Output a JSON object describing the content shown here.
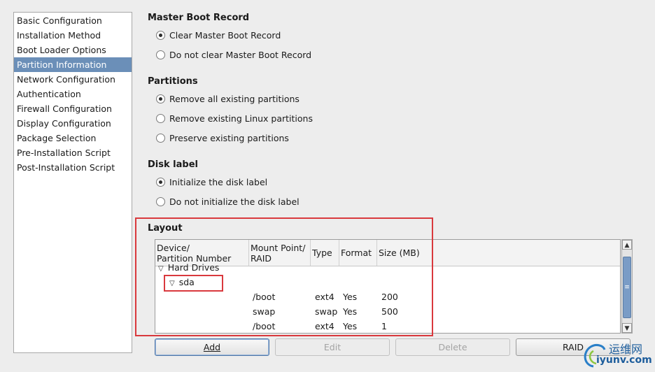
{
  "sidebar": {
    "items": [
      {
        "label": "Basic Configuration"
      },
      {
        "label": "Installation Method"
      },
      {
        "label": "Boot Loader Options"
      },
      {
        "label": "Partition Information",
        "selected": true
      },
      {
        "label": "Network Configuration"
      },
      {
        "label": "Authentication"
      },
      {
        "label": "Firewall Configuration"
      },
      {
        "label": "Display Configuration"
      },
      {
        "label": "Package Selection"
      },
      {
        "label": "Pre-Installation Script"
      },
      {
        "label": "Post-Installation Script"
      }
    ]
  },
  "mbr": {
    "title": "Master Boot Record",
    "options": [
      {
        "label": "Clear Master Boot Record",
        "checked": true
      },
      {
        "label": "Do not clear Master Boot Record",
        "checked": false
      }
    ]
  },
  "partitions": {
    "title": "Partitions",
    "options": [
      {
        "label": "Remove all existing partitions",
        "checked": true
      },
      {
        "label": "Remove existing Linux partitions",
        "checked": false
      },
      {
        "label": "Preserve existing partitions",
        "checked": false
      }
    ]
  },
  "disklabel": {
    "title": "Disk label",
    "options": [
      {
        "label": "Initialize the disk label",
        "checked": true
      },
      {
        "label": "Do not initialize the disk label",
        "checked": false
      }
    ]
  },
  "layout": {
    "title": "Layout",
    "columns": {
      "device": "Device/",
      "device2": "Partition Number",
      "mount": "Mount Point/",
      "mount2": "RAID",
      "type": "Type",
      "format": "Format",
      "size": "Size (MB)"
    },
    "group": "Hard Drives",
    "drive": "sda",
    "rows": [
      {
        "mount": "/boot",
        "type": "ext4",
        "format": "Yes",
        "size": "200"
      },
      {
        "mount": "swap",
        "type": "swap",
        "format": "Yes",
        "size": "500"
      },
      {
        "mount": "/boot",
        "type": "ext4",
        "format": "Yes",
        "size": "1"
      }
    ]
  },
  "buttons": {
    "add": "Add",
    "edit": "Edit",
    "delete": "Delete",
    "raid": "RAID"
  },
  "watermark": {
    "line1": "运维网",
    "line2": "iyunv.com"
  },
  "colors": {
    "selection": "#6b8fb8",
    "highlight": "#d9393d"
  }
}
